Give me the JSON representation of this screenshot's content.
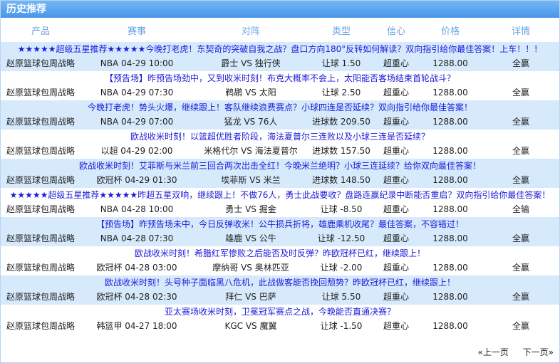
{
  "title": "历史推荐",
  "columns": [
    "产品",
    "赛事",
    "对阵",
    "类型",
    "信心",
    "价格",
    "详情"
  ],
  "records": [
    {
      "headline": "★★★★★超级五星推荐★★★★★今晚打老虎！东契奇的突破自我之战？盘口方向180°反转如何解读？双向指引给你最佳答案！上车！！！",
      "product": "赵原篮球包周战略",
      "event": "NBA 04-29 10:00",
      "match": "爵士 VS 独行侠",
      "type": "让球 1.50",
      "confidence": "超重心",
      "price": "1288.00",
      "detail": "全赢"
    },
    {
      "headline": "【预告场】昨预告场劲中，又到收米时刻！布克大概率不会上，太阳能否客场结束首轮战斗？",
      "product": "赵原篮球包周战略",
      "event": "NBA 04-29 07:30",
      "match": "鹈鹕 VS 太阳",
      "type": "让球 2.50",
      "confidence": "超重心",
      "price": "1288.00",
      "detail": "全赢"
    },
    {
      "headline": "今晚打老虎！势头火爆，继续跟上！客队继续浪费赛点？小球四连是否延续？双向指引给你最佳答案！",
      "product": "赵原篮球包周战略",
      "event": "NBA 04-29 07:00",
      "match": "猛龙 VS 76人",
      "type": "进球数 209.50",
      "confidence": "超重心",
      "price": "1288.00",
      "detail": "全赢"
    },
    {
      "headline": "欧战收米时刻！以篮超优胜者阶段，海法夏普尔三连败以及小球三连是否延续？",
      "product": "赵原篮球包周战略",
      "event": "以超 04-29 02:00",
      "match": "米格代尔 VS 海法夏普尔",
      "type": "进球数 157.50",
      "confidence": "超重心",
      "price": "1288.00",
      "detail": "全赢"
    },
    {
      "headline": "欧战收米时刻！艾菲斯与米兰前三回合两次出击全红！今晚米兰绝明？小球三连延续？给你双向最佳答案！",
      "product": "赵原篮球包周战略",
      "event": "欧冠杯 04-29 01:30",
      "match": "埃菲斯 VS 米兰",
      "type": "进球数 148.50",
      "confidence": "超重心",
      "price": "1288.00",
      "detail": "全赢"
    },
    {
      "headline": "★★★★★超级五星推荐★★★★★昨超五星双响，继续跟上！不做76人，勇士此战要收？盘路连赢纪录中断能否重启？双向指引给你最佳答案！",
      "product": "赵原篮球包周战略",
      "event": "NBA 04-28 10:00",
      "match": "勇士 VS 掘金",
      "type": "让球 -8.50",
      "confidence": "超重心",
      "price": "1288.00",
      "detail": "全输"
    },
    {
      "headline": "【预告场】昨预告场未中，今日反弹收米！公牛损兵折将，雄鹿乘机收尾？最佳答案，不容错过！",
      "product": "赵原篮球包周战略",
      "event": "NBA 04-28 07:30",
      "match": "雄鹿 VS 公牛",
      "type": "让球 -12.50",
      "confidence": "超重心",
      "price": "1288.00",
      "detail": "全赢"
    },
    {
      "headline": "欧战收米时刻！希腊红军惨败之后能否及时反弹？昨欧冠杯已红，继续跟上！",
      "product": "赵原篮球包周战略",
      "event": "欧冠杯 04-28 03:00",
      "match": "摩纳哥 VS 奥林匹亚",
      "type": "让球 -2.00",
      "confidence": "超重心",
      "price": "1288.00",
      "detail": "全赢"
    },
    {
      "headline": "欧战收米时刻！头号种子面临黑八危机，此战做客能否挽回颓势？昨欧冠杯已红，继续跟上！",
      "product": "赵原篮球包周战略",
      "event": "欧冠杯 04-28 02:30",
      "match": "拜仁 VS 巴萨",
      "type": "让球 5.50",
      "confidence": "超重心",
      "price": "1288.00",
      "detail": "全赢"
    },
    {
      "headline": "亚太赛场收米时刻，卫冕冠军赛点之战，今晚能否直通决赛？",
      "product": "赵原篮球包周战略",
      "event": "韩篮甲 04-27 18:00",
      "match": "KGC VS 魔翼",
      "type": "让球 -1.50",
      "confidence": "超重心",
      "price": "1288.00",
      "detail": "全赢"
    }
  ],
  "pager": {
    "prev": "«上一页",
    "next": "下一页»"
  }
}
